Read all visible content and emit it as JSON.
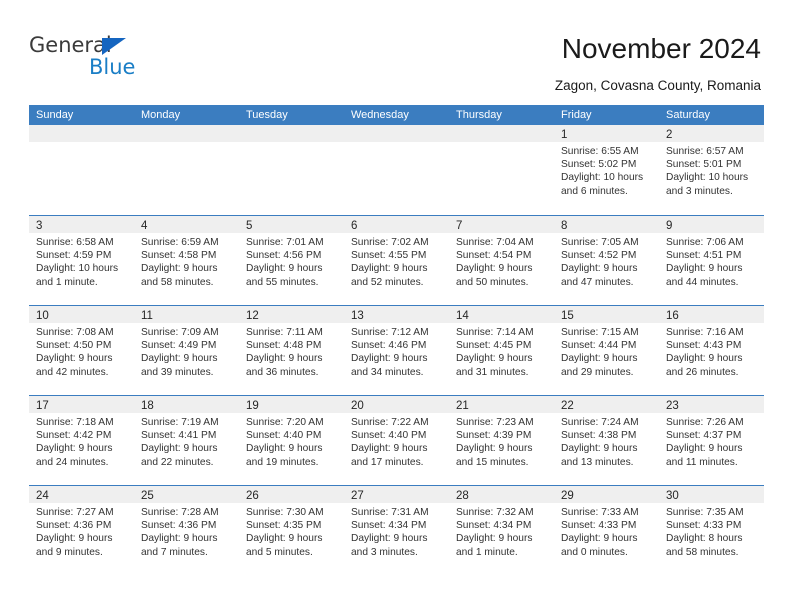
{
  "brand": {
    "name_part1": "General",
    "name_part2": "Blue",
    "triangle_color": "#1565c0",
    "blue_color": "#1a7ec6"
  },
  "header": {
    "title": "November 2024",
    "location": "Zagon, Covasna County, Romania"
  },
  "theme": {
    "header_blue": "#3b7dc0",
    "day_header_gray": "#efefef",
    "text": "#333333"
  },
  "calendar": {
    "weekdays": [
      "Sunday",
      "Monday",
      "Tuesday",
      "Wednesday",
      "Thursday",
      "Friday",
      "Saturday"
    ],
    "weeks": [
      [
        {
          "day": "",
          "empty": true
        },
        {
          "day": "",
          "empty": true
        },
        {
          "day": "",
          "empty": true
        },
        {
          "day": "",
          "empty": true
        },
        {
          "day": "",
          "empty": true
        },
        {
          "day": "1",
          "sunrise": "Sunrise: 6:55 AM",
          "sunset": "Sunset: 5:02 PM",
          "daylight": "Daylight: 10 hours and 6 minutes."
        },
        {
          "day": "2",
          "sunrise": "Sunrise: 6:57 AM",
          "sunset": "Sunset: 5:01 PM",
          "daylight": "Daylight: 10 hours and 3 minutes."
        }
      ],
      [
        {
          "day": "3",
          "sunrise": "Sunrise: 6:58 AM",
          "sunset": "Sunset: 4:59 PM",
          "daylight": "Daylight: 10 hours and 1 minute."
        },
        {
          "day": "4",
          "sunrise": "Sunrise: 6:59 AM",
          "sunset": "Sunset: 4:58 PM",
          "daylight": "Daylight: 9 hours and 58 minutes."
        },
        {
          "day": "5",
          "sunrise": "Sunrise: 7:01 AM",
          "sunset": "Sunset: 4:56 PM",
          "daylight": "Daylight: 9 hours and 55 minutes."
        },
        {
          "day": "6",
          "sunrise": "Sunrise: 7:02 AM",
          "sunset": "Sunset: 4:55 PM",
          "daylight": "Daylight: 9 hours and 52 minutes."
        },
        {
          "day": "7",
          "sunrise": "Sunrise: 7:04 AM",
          "sunset": "Sunset: 4:54 PM",
          "daylight": "Daylight: 9 hours and 50 minutes."
        },
        {
          "day": "8",
          "sunrise": "Sunrise: 7:05 AM",
          "sunset": "Sunset: 4:52 PM",
          "daylight": "Daylight: 9 hours and 47 minutes."
        },
        {
          "day": "9",
          "sunrise": "Sunrise: 7:06 AM",
          "sunset": "Sunset: 4:51 PM",
          "daylight": "Daylight: 9 hours and 44 minutes."
        }
      ],
      [
        {
          "day": "10",
          "sunrise": "Sunrise: 7:08 AM",
          "sunset": "Sunset: 4:50 PM",
          "daylight": "Daylight: 9 hours and 42 minutes."
        },
        {
          "day": "11",
          "sunrise": "Sunrise: 7:09 AM",
          "sunset": "Sunset: 4:49 PM",
          "daylight": "Daylight: 9 hours and 39 minutes."
        },
        {
          "day": "12",
          "sunrise": "Sunrise: 7:11 AM",
          "sunset": "Sunset: 4:48 PM",
          "daylight": "Daylight: 9 hours and 36 minutes."
        },
        {
          "day": "13",
          "sunrise": "Sunrise: 7:12 AM",
          "sunset": "Sunset: 4:46 PM",
          "daylight": "Daylight: 9 hours and 34 minutes."
        },
        {
          "day": "14",
          "sunrise": "Sunrise: 7:14 AM",
          "sunset": "Sunset: 4:45 PM",
          "daylight": "Daylight: 9 hours and 31 minutes."
        },
        {
          "day": "15",
          "sunrise": "Sunrise: 7:15 AM",
          "sunset": "Sunset: 4:44 PM",
          "daylight": "Daylight: 9 hours and 29 minutes."
        },
        {
          "day": "16",
          "sunrise": "Sunrise: 7:16 AM",
          "sunset": "Sunset: 4:43 PM",
          "daylight": "Daylight: 9 hours and 26 minutes."
        }
      ],
      [
        {
          "day": "17",
          "sunrise": "Sunrise: 7:18 AM",
          "sunset": "Sunset: 4:42 PM",
          "daylight": "Daylight: 9 hours and 24 minutes."
        },
        {
          "day": "18",
          "sunrise": "Sunrise: 7:19 AM",
          "sunset": "Sunset: 4:41 PM",
          "daylight": "Daylight: 9 hours and 22 minutes."
        },
        {
          "day": "19",
          "sunrise": "Sunrise: 7:20 AM",
          "sunset": "Sunset: 4:40 PM",
          "daylight": "Daylight: 9 hours and 19 minutes."
        },
        {
          "day": "20",
          "sunrise": "Sunrise: 7:22 AM",
          "sunset": "Sunset: 4:40 PM",
          "daylight": "Daylight: 9 hours and 17 minutes."
        },
        {
          "day": "21",
          "sunrise": "Sunrise: 7:23 AM",
          "sunset": "Sunset: 4:39 PM",
          "daylight": "Daylight: 9 hours and 15 minutes."
        },
        {
          "day": "22",
          "sunrise": "Sunrise: 7:24 AM",
          "sunset": "Sunset: 4:38 PM",
          "daylight": "Daylight: 9 hours and 13 minutes."
        },
        {
          "day": "23",
          "sunrise": "Sunrise: 7:26 AM",
          "sunset": "Sunset: 4:37 PM",
          "daylight": "Daylight: 9 hours and 11 minutes."
        }
      ],
      [
        {
          "day": "24",
          "sunrise": "Sunrise: 7:27 AM",
          "sunset": "Sunset: 4:36 PM",
          "daylight": "Daylight: 9 hours and 9 minutes."
        },
        {
          "day": "25",
          "sunrise": "Sunrise: 7:28 AM",
          "sunset": "Sunset: 4:36 PM",
          "daylight": "Daylight: 9 hours and 7 minutes."
        },
        {
          "day": "26",
          "sunrise": "Sunrise: 7:30 AM",
          "sunset": "Sunset: 4:35 PM",
          "daylight": "Daylight: 9 hours and 5 minutes."
        },
        {
          "day": "27",
          "sunrise": "Sunrise: 7:31 AM",
          "sunset": "Sunset: 4:34 PM",
          "daylight": "Daylight: 9 hours and 3 minutes."
        },
        {
          "day": "28",
          "sunrise": "Sunrise: 7:32 AM",
          "sunset": "Sunset: 4:34 PM",
          "daylight": "Daylight: 9 hours and 1 minute."
        },
        {
          "day": "29",
          "sunrise": "Sunrise: 7:33 AM",
          "sunset": "Sunset: 4:33 PM",
          "daylight": "Daylight: 9 hours and 0 minutes."
        },
        {
          "day": "30",
          "sunrise": "Sunrise: 7:35 AM",
          "sunset": "Sunset: 4:33 PM",
          "daylight": "Daylight: 8 hours and 58 minutes."
        }
      ]
    ]
  }
}
